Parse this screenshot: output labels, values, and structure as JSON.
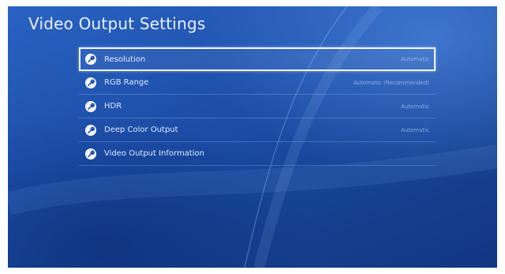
{
  "page": {
    "title": "Video Output Settings"
  },
  "menu": {
    "items": [
      {
        "label": "Resolution",
        "value": "Automatic",
        "selected": true,
        "icon": "wrench-icon"
      },
      {
        "label": "RGB Range",
        "value": "Automatic (Recommended)",
        "selected": false,
        "icon": "wrench-icon"
      },
      {
        "label": "HDR",
        "value": "Automatic",
        "selected": false,
        "icon": "wrench-icon"
      },
      {
        "label": "Deep Color Output",
        "value": "Automatic",
        "selected": false,
        "icon": "wrench-icon"
      },
      {
        "label": "Video Output Information",
        "value": "",
        "selected": false,
        "icon": "wrench-icon"
      }
    ]
  },
  "colors": {
    "background": "#1d4fa9",
    "text": "#dfe9ff",
    "highlight_border": "#f2f6ff"
  }
}
